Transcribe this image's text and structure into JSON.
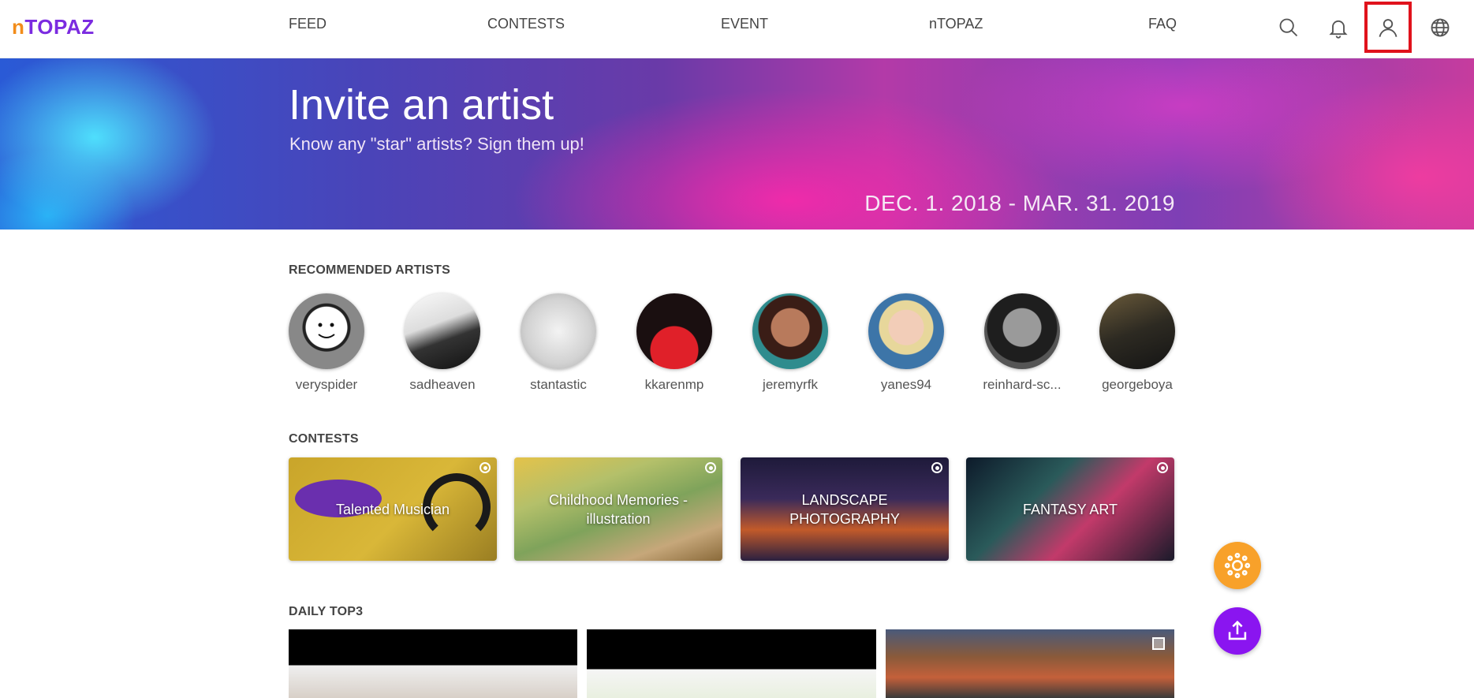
{
  "header": {
    "logo_text": "TOPAZ",
    "logo_mark": "n",
    "nav": [
      "FEED",
      "CONTESTS",
      "EVENT",
      "nTOPAZ",
      "FAQ"
    ],
    "icons": [
      "search-icon",
      "bell-icon",
      "user-icon",
      "globe-icon"
    ]
  },
  "banner": {
    "title": "Invite an artist",
    "subtitle": "Know any \"star\" artists? Sign them up!",
    "date_range": "DEC. 1. 2018 - MAR. 31. 2019"
  },
  "recommended": {
    "title": "RECOMMENDED ARTISTS",
    "artists": [
      "veryspider",
      "sadheaven",
      "stantastic",
      "kkarenmp",
      "jeremyrfk",
      "yanes94",
      "reinhard-sc...",
      "georgeboya"
    ]
  },
  "contests": {
    "title": "CONTESTS",
    "items": [
      "Talented Musician",
      "Childhood Memories - illustration",
      "LANDSCAPE PHOTOGRAPHY",
      "FANTASY ART"
    ]
  },
  "daily_top3": {
    "title": "DAILY TOP3"
  },
  "colors": {
    "brand_purple": "#7b2be0",
    "brand_orange": "#f28c1a",
    "fab_orange": "#f8a12a",
    "fab_purple": "#8a15f0",
    "highlight_red": "#e0121c"
  }
}
